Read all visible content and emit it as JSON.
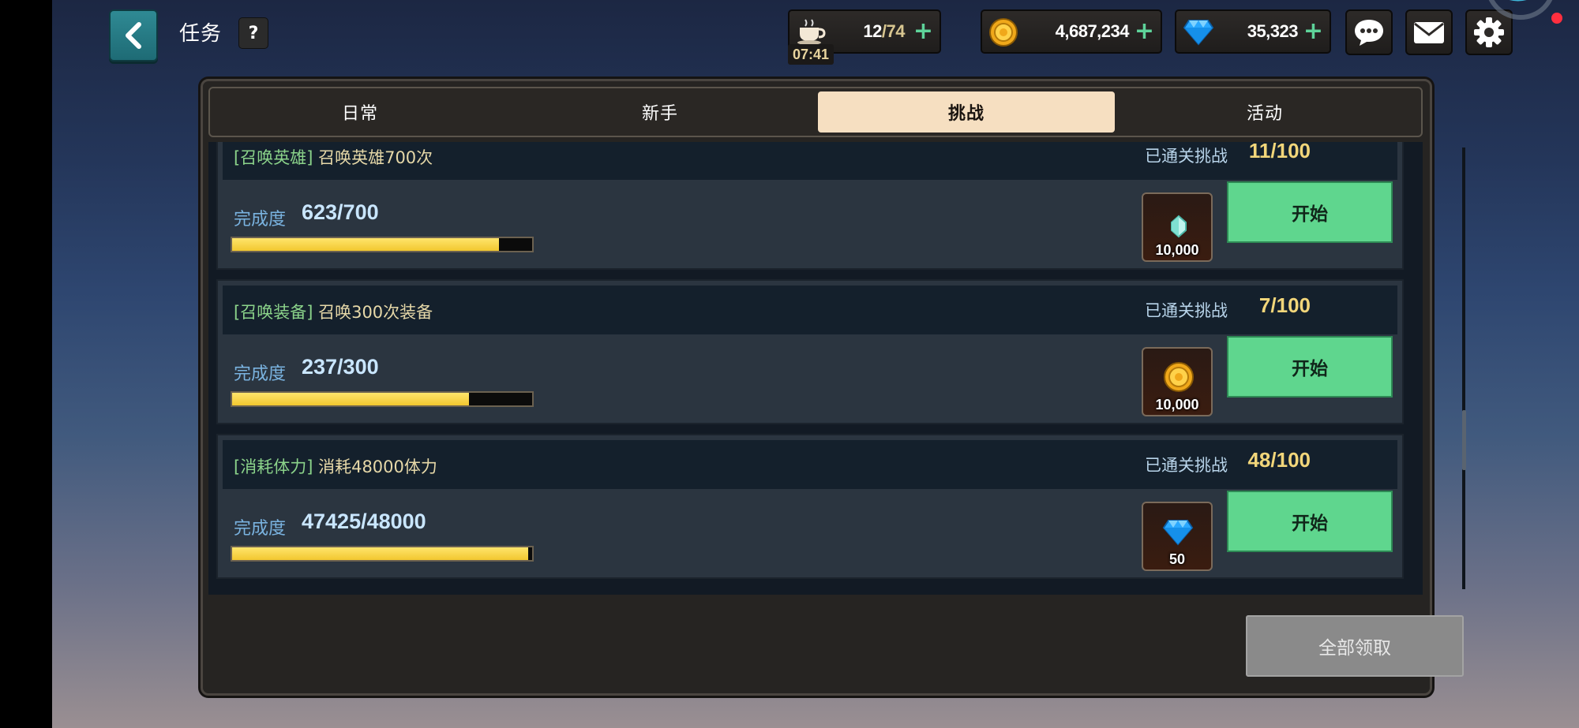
{
  "header": {
    "title": "任务",
    "help_label": "?"
  },
  "resources": {
    "stamina": {
      "current": "12",
      "max": "/74",
      "timer": "07:41",
      "icon": "coffee-cup-icon"
    },
    "gold": {
      "value": "4,687,234",
      "icon": "gold-coin-icon"
    },
    "gems": {
      "value": "35,323",
      "icon": "diamond-icon"
    },
    "plus_label": "+"
  },
  "top_buttons": [
    "chat-icon",
    "mail-icon",
    "settings-gear-icon"
  ],
  "tabs": [
    {
      "label": "日常",
      "active": false
    },
    {
      "label": "新手",
      "active": false
    },
    {
      "label": "挑战",
      "active": true
    },
    {
      "label": "活动",
      "active": false
    }
  ],
  "quests": [
    {
      "tag": "[召唤英雄]",
      "name": "召唤英雄700次",
      "cleared_label": "已通关挑战",
      "cleared_value": "11/100",
      "progress_label": "完成度",
      "progress_value": "623/700",
      "progress": 0.89,
      "reward_icon": "crystal-icon",
      "reward_amount": "10,000",
      "button_label": "开始"
    },
    {
      "tag": "[召唤装备]",
      "name": "召唤300次装备",
      "cleared_label": "已通关挑战",
      "cleared_value": "7/100",
      "progress_label": "完成度",
      "progress_value": "237/300",
      "progress": 0.79,
      "reward_icon": "gold-coin-icon",
      "reward_amount": "10,000",
      "button_label": "开始"
    },
    {
      "tag": "[消耗体力]",
      "name": "消耗48000体力",
      "cleared_label": "已通关挑战",
      "cleared_value": "48/100",
      "progress_label": "完成度",
      "progress_value": "47425/48000",
      "progress": 0.988,
      "reward_icon": "diamond-icon",
      "reward_amount": "50",
      "button_label": "开始"
    }
  ],
  "footer": {
    "claim_all_label": "全部领取"
  },
  "colors": {
    "accent_green": "#5fd68e",
    "progress_yellow": "#f2c72f",
    "tab_active": "#f6dfc1"
  }
}
